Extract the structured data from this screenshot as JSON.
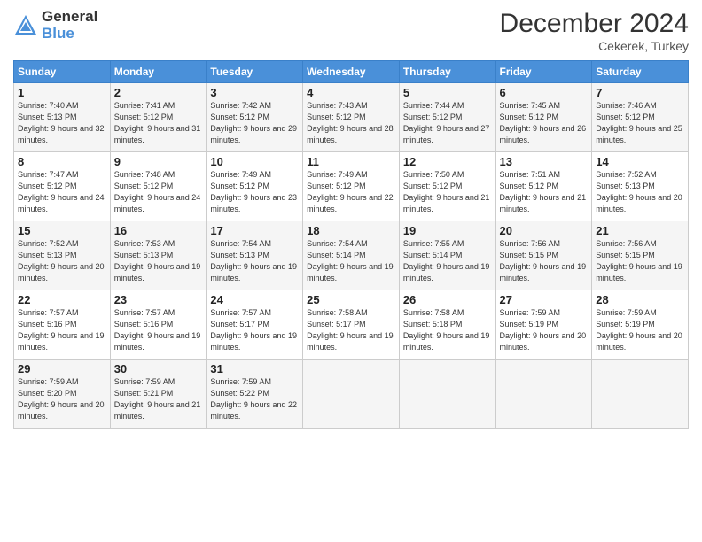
{
  "logo": {
    "line1": "General",
    "line2": "Blue"
  },
  "title": "December 2024",
  "location": "Cekerek, Turkey",
  "headers": [
    "Sunday",
    "Monday",
    "Tuesday",
    "Wednesday",
    "Thursday",
    "Friday",
    "Saturday"
  ],
  "weeks": [
    [
      {
        "day": "1",
        "sunrise": "Sunrise: 7:40 AM",
        "sunset": "Sunset: 5:13 PM",
        "daylight": "Daylight: 9 hours and 32 minutes."
      },
      {
        "day": "2",
        "sunrise": "Sunrise: 7:41 AM",
        "sunset": "Sunset: 5:12 PM",
        "daylight": "Daylight: 9 hours and 31 minutes."
      },
      {
        "day": "3",
        "sunrise": "Sunrise: 7:42 AM",
        "sunset": "Sunset: 5:12 PM",
        "daylight": "Daylight: 9 hours and 29 minutes."
      },
      {
        "day": "4",
        "sunrise": "Sunrise: 7:43 AM",
        "sunset": "Sunset: 5:12 PM",
        "daylight": "Daylight: 9 hours and 28 minutes."
      },
      {
        "day": "5",
        "sunrise": "Sunrise: 7:44 AM",
        "sunset": "Sunset: 5:12 PM",
        "daylight": "Daylight: 9 hours and 27 minutes."
      },
      {
        "day": "6",
        "sunrise": "Sunrise: 7:45 AM",
        "sunset": "Sunset: 5:12 PM",
        "daylight": "Daylight: 9 hours and 26 minutes."
      },
      {
        "day": "7",
        "sunrise": "Sunrise: 7:46 AM",
        "sunset": "Sunset: 5:12 PM",
        "daylight": "Daylight: 9 hours and 25 minutes."
      }
    ],
    [
      {
        "day": "8",
        "sunrise": "Sunrise: 7:47 AM",
        "sunset": "Sunset: 5:12 PM",
        "daylight": "Daylight: 9 hours and 24 minutes."
      },
      {
        "day": "9",
        "sunrise": "Sunrise: 7:48 AM",
        "sunset": "Sunset: 5:12 PM",
        "daylight": "Daylight: 9 hours and 24 minutes."
      },
      {
        "day": "10",
        "sunrise": "Sunrise: 7:49 AM",
        "sunset": "Sunset: 5:12 PM",
        "daylight": "Daylight: 9 hours and 23 minutes."
      },
      {
        "day": "11",
        "sunrise": "Sunrise: 7:49 AM",
        "sunset": "Sunset: 5:12 PM",
        "daylight": "Daylight: 9 hours and 22 minutes."
      },
      {
        "day": "12",
        "sunrise": "Sunrise: 7:50 AM",
        "sunset": "Sunset: 5:12 PM",
        "daylight": "Daylight: 9 hours and 21 minutes."
      },
      {
        "day": "13",
        "sunrise": "Sunrise: 7:51 AM",
        "sunset": "Sunset: 5:12 PM",
        "daylight": "Daylight: 9 hours and 21 minutes."
      },
      {
        "day": "14",
        "sunrise": "Sunrise: 7:52 AM",
        "sunset": "Sunset: 5:13 PM",
        "daylight": "Daylight: 9 hours and 20 minutes."
      }
    ],
    [
      {
        "day": "15",
        "sunrise": "Sunrise: 7:52 AM",
        "sunset": "Sunset: 5:13 PM",
        "daylight": "Daylight: 9 hours and 20 minutes."
      },
      {
        "day": "16",
        "sunrise": "Sunrise: 7:53 AM",
        "sunset": "Sunset: 5:13 PM",
        "daylight": "Daylight: 9 hours and 19 minutes."
      },
      {
        "day": "17",
        "sunrise": "Sunrise: 7:54 AM",
        "sunset": "Sunset: 5:13 PM",
        "daylight": "Daylight: 9 hours and 19 minutes."
      },
      {
        "day": "18",
        "sunrise": "Sunrise: 7:54 AM",
        "sunset": "Sunset: 5:14 PM",
        "daylight": "Daylight: 9 hours and 19 minutes."
      },
      {
        "day": "19",
        "sunrise": "Sunrise: 7:55 AM",
        "sunset": "Sunset: 5:14 PM",
        "daylight": "Daylight: 9 hours and 19 minutes."
      },
      {
        "day": "20",
        "sunrise": "Sunrise: 7:56 AM",
        "sunset": "Sunset: 5:15 PM",
        "daylight": "Daylight: 9 hours and 19 minutes."
      },
      {
        "day": "21",
        "sunrise": "Sunrise: 7:56 AM",
        "sunset": "Sunset: 5:15 PM",
        "daylight": "Daylight: 9 hours and 19 minutes."
      }
    ],
    [
      {
        "day": "22",
        "sunrise": "Sunrise: 7:57 AM",
        "sunset": "Sunset: 5:16 PM",
        "daylight": "Daylight: 9 hours and 19 minutes."
      },
      {
        "day": "23",
        "sunrise": "Sunrise: 7:57 AM",
        "sunset": "Sunset: 5:16 PM",
        "daylight": "Daylight: 9 hours and 19 minutes."
      },
      {
        "day": "24",
        "sunrise": "Sunrise: 7:57 AM",
        "sunset": "Sunset: 5:17 PM",
        "daylight": "Daylight: 9 hours and 19 minutes."
      },
      {
        "day": "25",
        "sunrise": "Sunrise: 7:58 AM",
        "sunset": "Sunset: 5:17 PM",
        "daylight": "Daylight: 9 hours and 19 minutes."
      },
      {
        "day": "26",
        "sunrise": "Sunrise: 7:58 AM",
        "sunset": "Sunset: 5:18 PM",
        "daylight": "Daylight: 9 hours and 19 minutes."
      },
      {
        "day": "27",
        "sunrise": "Sunrise: 7:59 AM",
        "sunset": "Sunset: 5:19 PM",
        "daylight": "Daylight: 9 hours and 20 minutes."
      },
      {
        "day": "28",
        "sunrise": "Sunrise: 7:59 AM",
        "sunset": "Sunset: 5:19 PM",
        "daylight": "Daylight: 9 hours and 20 minutes."
      }
    ],
    [
      {
        "day": "29",
        "sunrise": "Sunrise: 7:59 AM",
        "sunset": "Sunset: 5:20 PM",
        "daylight": "Daylight: 9 hours and 20 minutes."
      },
      {
        "day": "30",
        "sunrise": "Sunrise: 7:59 AM",
        "sunset": "Sunset: 5:21 PM",
        "daylight": "Daylight: 9 hours and 21 minutes."
      },
      {
        "day": "31",
        "sunrise": "Sunrise: 7:59 AM",
        "sunset": "Sunset: 5:22 PM",
        "daylight": "Daylight: 9 hours and 22 minutes."
      },
      null,
      null,
      null,
      null
    ]
  ]
}
